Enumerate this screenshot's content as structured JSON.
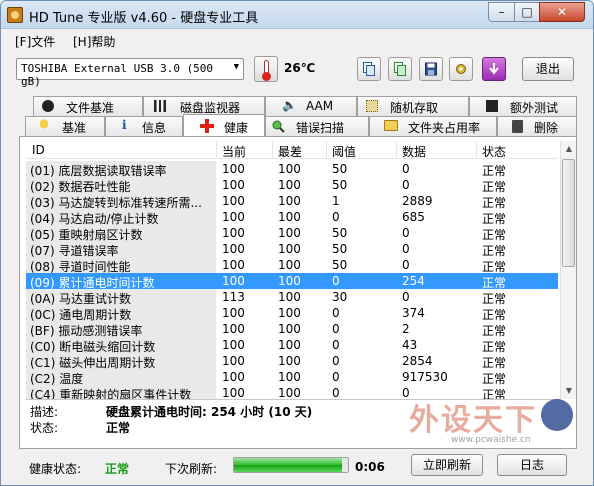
{
  "window": {
    "title": "HD Tune 专业版 v4.60 - 硬盘专业工具",
    "min_label": "–",
    "max_label": "□",
    "close_label": "✕"
  },
  "menu": [
    {
      "label": "[F]文件"
    },
    {
      "label": "[H]帮助"
    }
  ],
  "toolbar": {
    "drive": "TOSHIBA External USB 3.0 (500 gB)",
    "temperature": "26℃",
    "exit_label": "退出",
    "icons": [
      "copy-text-icon",
      "copy-screen-icon",
      "save-icon",
      "options-icon",
      "download-icon"
    ]
  },
  "tabs_top": [
    {
      "label": "文件基准",
      "icon": "file-benchmark-icon"
    },
    {
      "label": "磁盘监视器",
      "icon": "disk-monitor-icon"
    },
    {
      "label": "AAM",
      "icon": "speaker-icon"
    },
    {
      "label": "随机存取",
      "icon": "random-access-icon"
    },
    {
      "label": "额外测试",
      "icon": "extra-tests-icon"
    }
  ],
  "tabs_bottom": [
    {
      "label": "基准",
      "icon": "benchmark-icon"
    },
    {
      "label": "信息",
      "icon": "info-icon"
    },
    {
      "label": "健康",
      "icon": "health-cross-icon"
    },
    {
      "label": "错误扫描",
      "icon": "error-scan-icon"
    },
    {
      "label": "文件夹占用率",
      "icon": "folder-usage-icon"
    },
    {
      "label": "删除",
      "icon": "trash-icon"
    }
  ],
  "active_tab": "健康",
  "table": {
    "columns": [
      "ID",
      "当前",
      "最差",
      "阈值",
      "数据",
      "状态"
    ],
    "rows": [
      {
        "id": "(01) 底层数据读取错误率",
        "current": "100",
        "worst": "100",
        "threshold": "50",
        "data": "0",
        "status": "正常"
      },
      {
        "id": "(02) 数据吞吐性能",
        "current": "100",
        "worst": "100",
        "threshold": "50",
        "data": "0",
        "status": "正常"
      },
      {
        "id": "(03) 马达旋转到标准转速所需...",
        "current": "100",
        "worst": "100",
        "threshold": "1",
        "data": "2889",
        "status": "正常"
      },
      {
        "id": "(04) 马达启动/停止计数",
        "current": "100",
        "worst": "100",
        "threshold": "0",
        "data": "685",
        "status": "正常"
      },
      {
        "id": "(05) 重映射扇区计数",
        "current": "100",
        "worst": "100",
        "threshold": "50",
        "data": "0",
        "status": "正常"
      },
      {
        "id": "(07) 寻道错误率",
        "current": "100",
        "worst": "100",
        "threshold": "50",
        "data": "0",
        "status": "正常"
      },
      {
        "id": "(08) 寻道时间性能",
        "current": "100",
        "worst": "100",
        "threshold": "50",
        "data": "0",
        "status": "正常"
      },
      {
        "id": "(09) 累计通电时间计数",
        "current": "100",
        "worst": "100",
        "threshold": "0",
        "data": "254",
        "status": "正常",
        "selected": true
      },
      {
        "id": "(0A) 马达重试计数",
        "current": "113",
        "worst": "100",
        "threshold": "30",
        "data": "0",
        "status": "正常"
      },
      {
        "id": "(0C) 通电周期计数",
        "current": "100",
        "worst": "100",
        "threshold": "0",
        "data": "374",
        "status": "正常"
      },
      {
        "id": "(BF) 振动感测错误率",
        "current": "100",
        "worst": "100",
        "threshold": "0",
        "data": "2",
        "status": "正常"
      },
      {
        "id": "(C0) 断电磁头缩回计数",
        "current": "100",
        "worst": "100",
        "threshold": "0",
        "data": "43",
        "status": "正常"
      },
      {
        "id": "(C1) 磁头伸出周期计数",
        "current": "100",
        "worst": "100",
        "threshold": "0",
        "data": "2854",
        "status": "正常"
      },
      {
        "id": "(C2) 温度",
        "current": "100",
        "worst": "100",
        "threshold": "0",
        "data": "917530",
        "status": "正常"
      },
      {
        "id": "(C4) 重新映射的扇区事件计数",
        "current": "100",
        "worst": "100",
        "threshold": "0",
        "data": "0",
        "status": "正常"
      }
    ]
  },
  "description": {
    "label": "描述:",
    "value": "硬盘累计通电时间: 254 小时 (10 天)",
    "status_label": "状态:",
    "status_value": "正常"
  },
  "footer": {
    "health_label": "健康状态:",
    "health_value": "正常",
    "refresh_label": "下次刷新:",
    "refresh_progress": 0.95,
    "countdown": "0:06",
    "refresh_button": "立即刷新",
    "log_button": "日志"
  },
  "watermark": {
    "text": "外设天下",
    "url": "www.pcwaishe.cn"
  }
}
